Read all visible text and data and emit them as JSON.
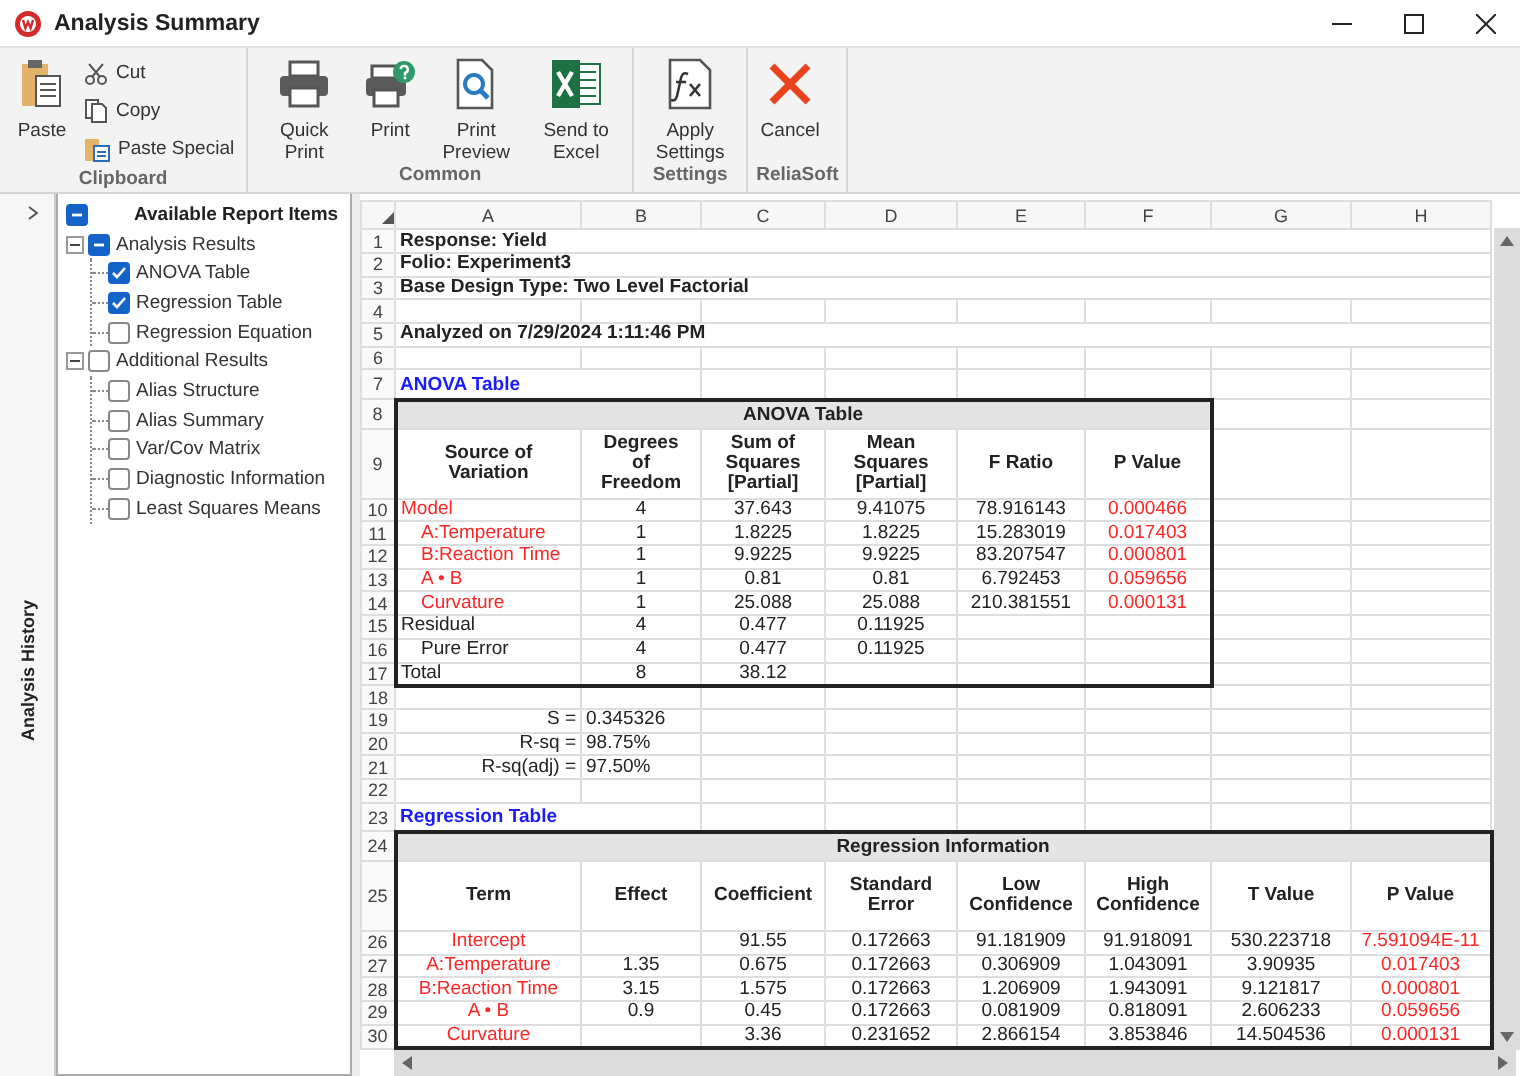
{
  "window": {
    "title": "Analysis Summary"
  },
  "ribbon": {
    "groups": [
      {
        "label": "Clipboard",
        "buttons": [
          {
            "label": "Paste",
            "kind": "large"
          },
          {
            "label": "Cut",
            "kind": "small"
          },
          {
            "label": "Copy",
            "kind": "small"
          },
          {
            "label": "Paste Special",
            "kind": "small"
          }
        ]
      },
      {
        "label": "Common",
        "buttons": [
          {
            "label": "Quick Print",
            "kind": "large"
          },
          {
            "label": "Print",
            "kind": "large"
          },
          {
            "label": "Print Preview",
            "kind": "large"
          },
          {
            "label": "Send to Excel",
            "kind": "large"
          }
        ]
      },
      {
        "label": "Settings",
        "buttons": [
          {
            "label": "Apply Settings",
            "kind": "large"
          }
        ]
      },
      {
        "label": "ReliaSoft",
        "buttons": [
          {
            "label": "Cancel",
            "kind": "large"
          }
        ]
      }
    ]
  },
  "side_tab": {
    "label": "Analysis History"
  },
  "report_tree": {
    "label": "Available Report Items",
    "partial": true,
    "children": [
      {
        "label": "Analysis Results",
        "partial": true,
        "expanded": true,
        "children": [
          {
            "label": "ANOVA Table",
            "checked": true
          },
          {
            "label": "Regression Table",
            "checked": true
          },
          {
            "label": "Regression Equation",
            "checked": false
          }
        ]
      },
      {
        "label": "Additional Results",
        "checked": false,
        "expanded": true,
        "children": [
          {
            "label": "Alias Structure",
            "checked": false
          },
          {
            "label": "Alias Summary",
            "checked": false
          },
          {
            "label": "Var/Cov Matrix",
            "checked": false
          },
          {
            "label": "Diagnostic Information",
            "checked": false
          },
          {
            "label": "Least Squares Means",
            "checked": false
          }
        ]
      }
    ]
  },
  "sheet": {
    "columns": [
      "A",
      "B",
      "C",
      "D",
      "E",
      "F",
      "G",
      "H"
    ],
    "blocks": [
      {
        "kind": "info",
        "row": "1",
        "text": "Response: Yield"
      },
      {
        "kind": "info",
        "row": "2",
        "text": "Folio: Experiment3"
      },
      {
        "kind": "info",
        "row": "3",
        "text": "Base Design Type: Two Level Factorial"
      },
      {
        "kind": "blank",
        "row": "4"
      },
      {
        "kind": "info",
        "row": "5",
        "text": "Analyzed on 7/29/2024 1:11:46 PM"
      },
      {
        "kind": "blank",
        "row": "6"
      },
      {
        "kind": "heading",
        "row": "7",
        "text": "ANOVA Table"
      },
      {
        "kind": "anova_table",
        "title_row": "8",
        "title": "ANOVA Table",
        "header_row": "9",
        "columns": [
          "Source of Variation",
          "Degrees of Freedom",
          "Sum of Squares [Partial]",
          "Mean Squares [Partial]",
          "F Ratio",
          "P Value"
        ],
        "rows": [
          {
            "row": "10",
            "significant": true,
            "indented": false,
            "cells": [
              "Model",
              "4",
              "37.643",
              "9.41075",
              "78.916143",
              "0.000466"
            ]
          },
          {
            "row": "11",
            "significant": true,
            "indented": true,
            "cells": [
              "A:Temperature",
              "1",
              "1.8225",
              "1.8225",
              "15.283019",
              "0.017403"
            ]
          },
          {
            "row": "12",
            "significant": true,
            "indented": true,
            "cells": [
              "B:Reaction Time",
              "1",
              "9.9225",
              "9.9225",
              "83.207547",
              "0.000801"
            ]
          },
          {
            "row": "13",
            "significant": true,
            "indented": true,
            "cells": [
              "A • B",
              "1",
              "0.81",
              "0.81",
              "6.792453",
              "0.059656"
            ]
          },
          {
            "row": "14",
            "significant": true,
            "indented": true,
            "cells": [
              "Curvature",
              "1",
              "25.088",
              "25.088",
              "210.381551",
              "0.000131"
            ]
          },
          {
            "row": "15",
            "significant": false,
            "indented": false,
            "cells": [
              "Residual",
              "4",
              "0.477",
              "0.11925"
            ]
          },
          {
            "row": "16",
            "significant": false,
            "indented": true,
            "cells": [
              "Pure Error",
              "4",
              "0.477",
              "0.11925"
            ]
          },
          {
            "row": "17",
            "significant": false,
            "indented": false,
            "cells": [
              "Total",
              "8",
              "38.12"
            ]
          }
        ]
      },
      {
        "kind": "blank",
        "row": "18"
      },
      {
        "kind": "stat",
        "row": "19",
        "label": "S =",
        "value": "0.345326"
      },
      {
        "kind": "stat",
        "row": "20",
        "label": "R-sq =",
        "value": "98.75%"
      },
      {
        "kind": "stat",
        "row": "21",
        "label": "R-sq(adj) =",
        "value": "97.50%"
      },
      {
        "kind": "blank",
        "row": "22"
      },
      {
        "kind": "heading",
        "row": "23",
        "text": "Regression Table"
      },
      {
        "kind": "regression_table",
        "title_row": "24",
        "title": "Regression Information",
        "header_row": "25",
        "columns": [
          "Term",
          "Effect",
          "Coefficient",
          "Standard Error",
          "Low Confidence",
          "High Confidence",
          "T Value",
          "P Value"
        ],
        "rows": [
          {
            "row": "26",
            "significant": true,
            "cells": [
              "Intercept",
              null,
              "91.55",
              "0.172663",
              "91.181909",
              "91.918091",
              "530.223718",
              "7.591094E-11"
            ]
          },
          {
            "row": "27",
            "significant": true,
            "cells": [
              "A:Temperature",
              "1.35",
              "0.675",
              "0.172663",
              "0.306909",
              "1.043091",
              "3.90935",
              "0.017403"
            ]
          },
          {
            "row": "28",
            "significant": true,
            "cells": [
              "B:Reaction Time",
              "3.15",
              "1.575",
              "0.172663",
              "1.206909",
              "1.943091",
              "9.121817",
              "0.000801"
            ]
          },
          {
            "row": "29",
            "significant": true,
            "cells": [
              "A • B",
              "0.9",
              "0.45",
              "0.172663",
              "0.081909",
              "0.818091",
              "2.606233",
              "0.059656"
            ]
          },
          {
            "row": "30",
            "significant": true,
            "cells": [
              "Curvature",
              null,
              "3.36",
              "0.231652",
              "2.866154",
              "3.853846",
              "14.504536",
              "0.000131"
            ]
          }
        ]
      }
    ]
  }
}
